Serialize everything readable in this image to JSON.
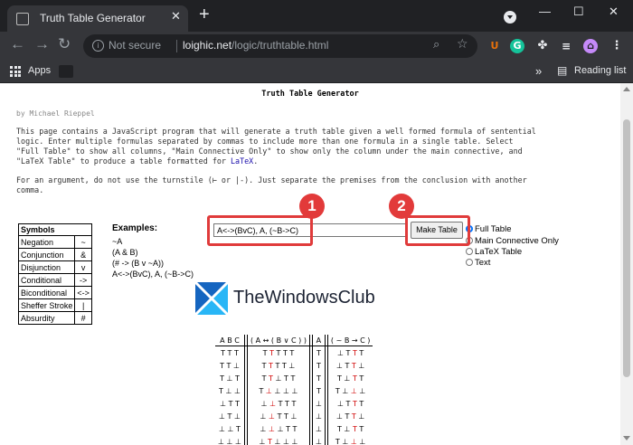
{
  "browser": {
    "tab_title": "Truth Table Generator",
    "tab_close": "✕",
    "new_tab": "+",
    "window_controls": {
      "minimize": "—",
      "maximize": "☐",
      "close": "✕"
    },
    "nav": {
      "back": "←",
      "forward": "→",
      "reload": "↻"
    },
    "security_label": "Not secure",
    "url_host": "loighic.net",
    "url_path": "/logic/truthtable.html",
    "extensions": [
      {
        "name": "U",
        "color": "#e8710a"
      },
      {
        "name": "G",
        "color": "#15c39a"
      }
    ],
    "bookmarks_apps": "Apps",
    "bookmarks_more": "»",
    "reading_list": "Reading list"
  },
  "page": {
    "title": "Truth Table Generator",
    "byline": "by Michael Rieppel",
    "intro_lines": [
      "This page contains a JavaScript program that will generate a truth table given a well formed formula of sentential",
      "logic. Enter multiple formulas separated by commas to include more than one formula in a single table. Select",
      "\"Full Table\" to show all columns, \"Main Connective Only\" to show only the column under the main connective, and"
    ],
    "intro_last_prefix": "\"LaTeX Table\" to produce a table formatted for ",
    "intro_last_link": "LaTeX",
    "intro_last_suffix": ".",
    "argument_lines": [
      "For an argument, do not use the turnstile (⊢ or |-). Just separate the premises from the conclusion with another",
      "comma."
    ],
    "symbols_header": "Symbols",
    "symbols": [
      {
        "name": "Negation",
        "sym": "~"
      },
      {
        "name": "Conjunction",
        "sym": "&"
      },
      {
        "name": "Disjunction",
        "sym": "v"
      },
      {
        "name": "Conditional",
        "sym": "->"
      },
      {
        "name": "Biconditional",
        "sym": "<->"
      },
      {
        "name": "Sheffer Stroke",
        "sym": "|"
      },
      {
        "name": "Absurdity",
        "sym": "#"
      }
    ],
    "examples_label": "Examples:",
    "examples": [
      "~A",
      "(A & B)",
      "(# -> (B v ~A))",
      "A<->(BvC), A, (~B->C)"
    ],
    "formula_value": "A<->(BvC), A, (~B->C)",
    "make_table_label": "Make Table",
    "options": [
      {
        "label": "Full Table",
        "selected": true
      },
      {
        "label": "Main Connective Only",
        "selected": false
      },
      {
        "label": "LaTeX Table",
        "selected": false
      },
      {
        "label": "Text",
        "selected": false
      }
    ],
    "badge_1": "1",
    "badge_2": "2",
    "watermark_text": "TheWindowsClub",
    "truth_table": {
      "header": [
        "A B C",
        "( A ↔ ( B ∨ C ) )",
        "A",
        "( ~ B → C )"
      ],
      "rows": [
        [
          "T T T",
          "T T   T T T",
          "T",
          "⊥ T T T"
        ],
        [
          "T T ⊥",
          "T T   T T ⊥",
          "T",
          "⊥ T T ⊥"
        ],
        [
          "T ⊥ T",
          "T T   ⊥ T T",
          "T",
          "T ⊥ T T"
        ],
        [
          "T ⊥ ⊥",
          "T ⊥   ⊥ ⊥ ⊥",
          "T",
          "T ⊥ ⊥ ⊥"
        ],
        [
          "⊥ T T",
          "⊥ ⊥   T T T",
          "⊥",
          "⊥ T T T"
        ],
        [
          "⊥ T ⊥",
          "⊥ ⊥   T T ⊥",
          "⊥",
          "⊥ T T ⊥"
        ],
        [
          "⊥ ⊥ T",
          "⊥ ⊥   ⊥ T T",
          "⊥",
          "T ⊥ T T"
        ],
        [
          "⊥ ⊥ ⊥",
          "⊥ T   ⊥ ⊥ ⊥",
          "⊥",
          "T ⊥ ⊥ ⊥"
        ]
      ]
    }
  }
}
